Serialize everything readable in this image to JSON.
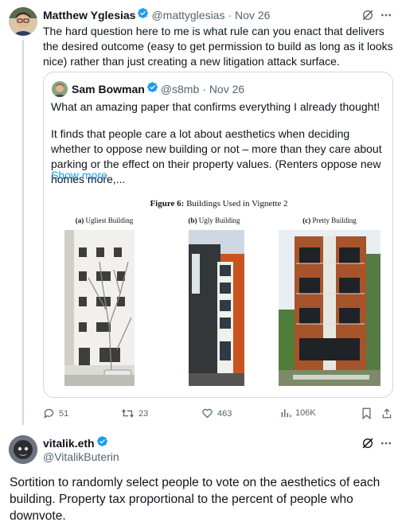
{
  "tweet1": {
    "name": "Matthew Yglesias",
    "handle": "@mattyglesias",
    "date": "· Nov 26",
    "text": "The hard question here to me is what rule can you enact that delivers the desired outcome (easy to get permission to build as long as it looks nice) rather than just creating a new litigation attack surface.",
    "quote": {
      "name": "Sam Bowman",
      "handle": "@s8mb",
      "date": "· Nov 26",
      "text1": "What an amazing paper that confirms everything I already thought!",
      "text2": "It finds that people care a lot about aesthetics when deciding whether to oppose new building or not – more than they care about parking or the effect on their property values. (Renters oppose new homes more,...",
      "show_more": "Show more",
      "figure": {
        "title_bold": "Figure 6:",
        "title_rest": " Buildings Used in Vignette 2",
        "captions": [
          {
            "tag": "(a)",
            "label": " Ugliest Building"
          },
          {
            "tag": "(b)",
            "label": " Ugly Building"
          },
          {
            "tag": "(c)",
            "label": " Pretty Building"
          }
        ]
      }
    },
    "actions": {
      "replies": "51",
      "retweets": "23",
      "likes": "463",
      "views": "106K"
    }
  },
  "tweet2": {
    "name": "vitalik.eth",
    "handle": "@VitalikButerin",
    "text": "Sortition to randomly select people to vote on the aesthetics of each building. Property tax proportional to the percent of people who downvote."
  },
  "colors": {
    "verified": "#1d9bf0",
    "muted": "#536471",
    "link": "#1d9bf0",
    "border": "#cfd9de"
  },
  "icons": [
    "verified-badge-icon",
    "grok-icon",
    "more-icon",
    "reply-icon",
    "retweet-icon",
    "like-icon",
    "views-icon",
    "bookmark-icon",
    "share-icon"
  ]
}
